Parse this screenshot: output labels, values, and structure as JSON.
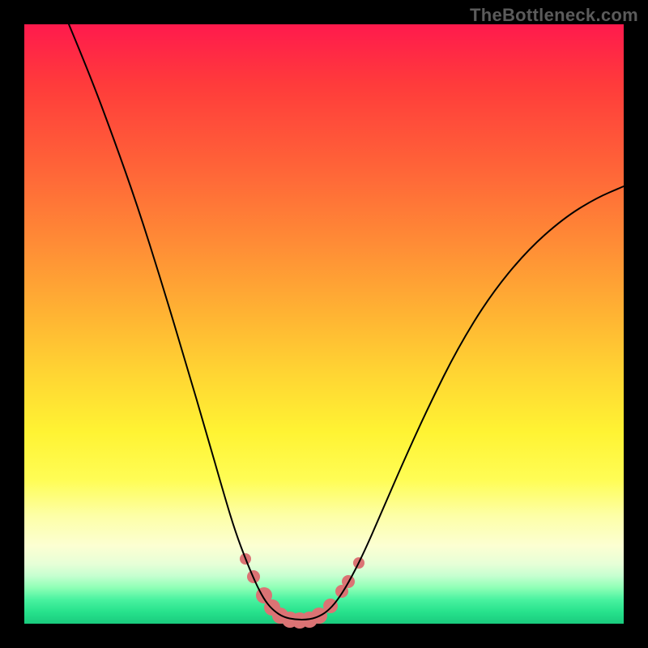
{
  "watermark": "TheBottleneck.com",
  "colors": {
    "frame": "#000000",
    "curve_stroke": "#000000",
    "marker_fill": "#db7374",
    "gradient_top": "#ff1a4d",
    "gradient_bottom": "#1acb7e"
  },
  "chart_data": {
    "type": "line",
    "title": "",
    "xlabel": "",
    "ylabel": "",
    "xlim": [
      0,
      740
    ],
    "ylim_inverted": [
      0,
      740
    ],
    "note": "y-axis is inverted (0 at top, 740 at bottom of plot area); values are pixel coordinates within the 740×740 plot area",
    "series": [
      {
        "name": "bottleneck-curve",
        "points": [
          [
            55,
            0
          ],
          [
            80,
            60
          ],
          [
            110,
            140
          ],
          [
            140,
            225
          ],
          [
            170,
            320
          ],
          [
            200,
            420
          ],
          [
            225,
            505
          ],
          [
            245,
            575
          ],
          [
            260,
            625
          ],
          [
            275,
            665
          ],
          [
            288,
            695
          ],
          [
            298,
            713
          ],
          [
            308,
            724
          ],
          [
            320,
            732
          ],
          [
            335,
            735
          ],
          [
            350,
            735
          ],
          [
            362,
            732
          ],
          [
            374,
            725
          ],
          [
            386,
            712
          ],
          [
            400,
            690
          ],
          [
            418,
            655
          ],
          [
            440,
            605
          ],
          [
            468,
            540
          ],
          [
            500,
            470
          ],
          [
            535,
            400
          ],
          [
            575,
            335
          ],
          [
            620,
            280
          ],
          [
            665,
            240
          ],
          [
            705,
            215
          ],
          [
            740,
            200
          ]
        ]
      }
    ],
    "markers": {
      "name": "bottom-cluster",
      "points": [
        {
          "x": 273,
          "y": 660,
          "r": 7
        },
        {
          "x": 283,
          "y": 682,
          "r": 8
        },
        {
          "x": 296,
          "y": 705,
          "r": 10
        },
        {
          "x": 306,
          "y": 720,
          "r": 10
        },
        {
          "x": 316,
          "y": 730,
          "r": 10
        },
        {
          "x": 328,
          "y": 735,
          "r": 10
        },
        {
          "x": 340,
          "y": 736,
          "r": 10
        },
        {
          "x": 352,
          "y": 735,
          "r": 10
        },
        {
          "x": 364,
          "y": 730,
          "r": 10
        },
        {
          "x": 378,
          "y": 718,
          "r": 9
        },
        {
          "x": 392,
          "y": 700,
          "r": 8
        },
        {
          "x": 400,
          "y": 688,
          "r": 8
        },
        {
          "x": 413,
          "y": 665,
          "r": 7
        }
      ]
    }
  }
}
